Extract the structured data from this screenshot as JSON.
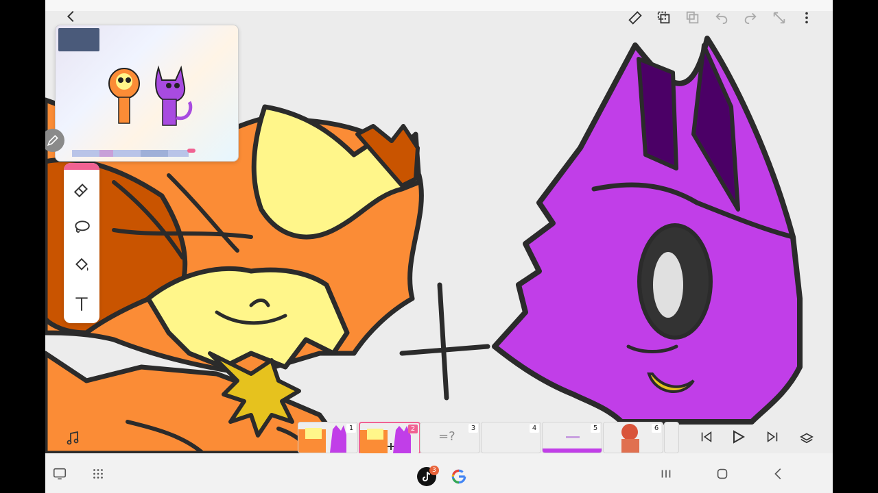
{
  "app": {
    "name": "Animation drawing app"
  },
  "top_toolbar": {
    "icons": [
      "back-icon",
      "ruler-icon",
      "copy-icon",
      "paste-icon",
      "undo-icon",
      "redo-icon",
      "expand-icon",
      "more-icon"
    ]
  },
  "tools": [
    "eraser-icon",
    "lasso-icon",
    "fill-bucket-icon",
    "text-icon"
  ],
  "canvas": {
    "plus_sign": "+",
    "colors": {
      "orange": "#fb8c36",
      "dark_orange": "#c95400",
      "yellow": "#fff68a",
      "purple": "#c13ee8",
      "dark_purple": "#4b0066",
      "gold": "#e6c21e",
      "stroke": "#2b2b2b"
    }
  },
  "timeline": {
    "frames": [
      {
        "number": "1",
        "selected": false
      },
      {
        "number": "2",
        "selected": true
      },
      {
        "number": "3",
        "selected": false,
        "label": "=?"
      },
      {
        "number": "4",
        "selected": false
      },
      {
        "number": "5",
        "selected": false
      },
      {
        "number": "6",
        "selected": false
      }
    ]
  },
  "playback": [
    "skip-back-icon",
    "play-icon",
    "skip-forward-icon",
    "layers-icon"
  ],
  "navbar": {
    "tiktok_badge": "3",
    "icons": [
      "screen-icon",
      "apps-grid-icon",
      "tiktok-icon",
      "google-icon",
      "recents-icon",
      "home-icon",
      "nav-back-icon"
    ]
  },
  "accent_color": "#f06292"
}
